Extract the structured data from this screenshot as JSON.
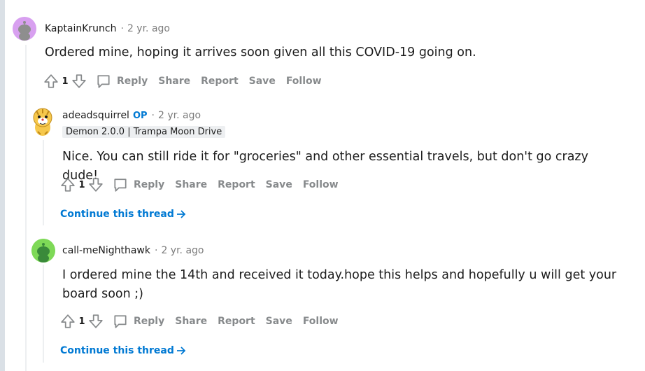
{
  "comments": [
    {
      "author": "KaptainKrunch",
      "age": "2 yr. ago",
      "body": "Ordered mine, hoping it arrives soon given all this COVID-19 going on.",
      "score": "1",
      "avatar": "snoo-avatar-purple",
      "avatar_color": "#d8a0f0"
    },
    {
      "author": "adeadsquirrel",
      "op": "OP",
      "age": "2 yr. ago",
      "flair": "Demon 2.0.0 | Trampa Moon Drive",
      "body": "Nice. You can still ride it for \"groceries\" and other essential travels, but don't go crazy dude!",
      "score": "1",
      "avatar": "tiger-avatar",
      "continue": "Continue this thread"
    },
    {
      "author": "call-meNighthawk",
      "age": "2 yr. ago",
      "body": "I ordered mine the 14th and received it today.hope this helps and hopefully u will get your board soon ;)",
      "score": "1",
      "avatar": "snoo-avatar-green",
      "avatar_color": "#7ed957",
      "continue": "Continue this thread"
    }
  ],
  "actions": {
    "reply": "Reply",
    "share": "Share",
    "report": "Report",
    "save": "Save",
    "follow": "Follow"
  },
  "colors": {
    "link": "#0079d3",
    "meta": "#7c7c7c",
    "action": "#878a8c",
    "op": "#0079d3"
  }
}
